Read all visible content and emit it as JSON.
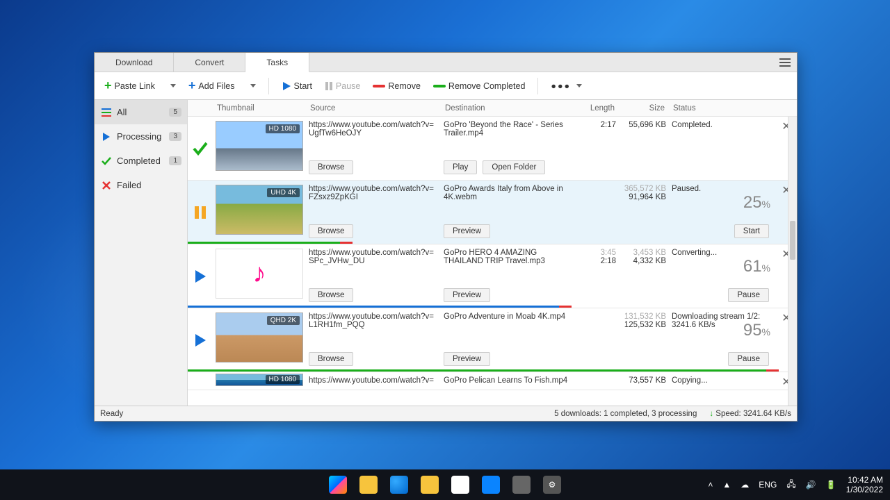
{
  "tabs": {
    "download": "Download",
    "convert": "Convert",
    "tasks": "Tasks"
  },
  "toolbar": {
    "paste": "Paste Link",
    "add": "Add Files",
    "start": "Start",
    "pause": "Pause",
    "remove": "Remove",
    "remove_completed": "Remove Completed"
  },
  "sidebar": {
    "all": {
      "label": "All",
      "count": "5"
    },
    "processing": {
      "label": "Processing",
      "count": "3"
    },
    "completed": {
      "label": "Completed",
      "count": "1"
    },
    "failed": {
      "label": "Failed"
    }
  },
  "columns": {
    "thumb": "Thumbnail",
    "src": "Source",
    "dest": "Destination",
    "len": "Length",
    "size": "Size",
    "status": "Status"
  },
  "rows": [
    {
      "badge": "HD 1080",
      "src": "https://www.youtube.com/watch?v=UgfTw6HeOJY",
      "dest": "GoPro 'Beyond the Race' - Series Trailer.mp4",
      "len": "2:17",
      "size": "55,696 KB",
      "status": "Completed.",
      "btn_src": "Browse",
      "btn_d1": "Play",
      "btn_d2": "Open Folder"
    },
    {
      "badge": "UHD 4K",
      "src": "https://www.youtube.com/watch?v=FZsxz9ZpKGI",
      "dest": "GoPro Awards  Italy from Above in 4K.webm",
      "size_total": "365,572 KB",
      "size": "91,964 KB",
      "status": "Paused.",
      "pct": "25",
      "btn_src": "Browse",
      "btn_d1": "Preview",
      "btn_stat": "Start"
    },
    {
      "src": "https://www.youtube.com/watch?v=SPc_JVHw_DU",
      "dest": "GoPro HERO 4   AMAZING THAILAND TRIP   Travel.mp3",
      "len_total": "3:45",
      "len": "2:18",
      "size_total": "3,453 KB",
      "size": "4,332 KB",
      "status": "Converting...",
      "pct": "61",
      "btn_src": "Browse",
      "btn_d1": "Preview",
      "btn_stat": "Pause"
    },
    {
      "badge": "QHD 2K",
      "src": "https://www.youtube.com/watch?v=L1RH1fm_PQQ",
      "dest": "GoPro  Adventure in Moab 4K.mp4",
      "size_total": "131,532 KB",
      "size": "125,532 KB",
      "status": "Downloading stream 1/2: 3241.6 KB/s",
      "pct": "95",
      "btn_src": "Browse",
      "btn_d1": "Preview",
      "btn_stat": "Pause"
    },
    {
      "badge": "HD 1080",
      "src": "https://www.youtube.com/watch?v=",
      "dest": "GoPro  Pelican Learns To Fish.mp4",
      "size": "73,557 KB",
      "status": "Copying..."
    }
  ],
  "statusbar": {
    "ready": "Ready",
    "summary": "5 downloads: 1 completed, 3 processing",
    "speed": "Speed: 3241.64 KB/s"
  },
  "tray": {
    "lang": "ENG",
    "time": "10:42 AM",
    "date": "1/30/2022"
  }
}
